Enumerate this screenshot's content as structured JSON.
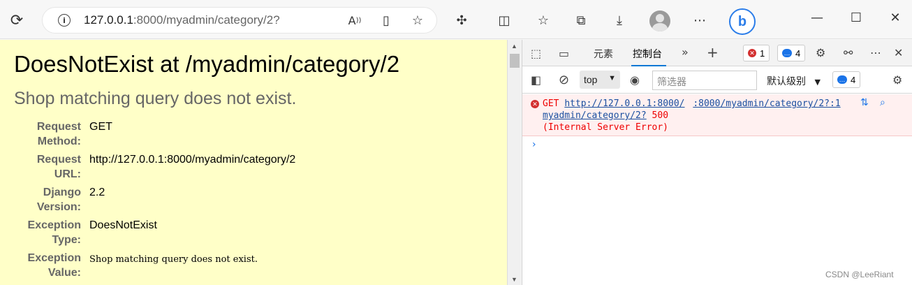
{
  "browser": {
    "url_host": "127.0.0.1",
    "url_rest": ":8000/myadmin/category/2?",
    "icons": [
      "refresh-icon",
      "info-icon",
      "read-aloud-icon",
      "immersive-reader-icon",
      "favorite-add-icon",
      "extensions-icon",
      "split-screen-icon",
      "favorites-icon",
      "collections-icon",
      "downloads-icon",
      "profile-avatar",
      "more-icon",
      "bing-icon",
      "minimize-icon",
      "maximize-icon",
      "close-icon"
    ]
  },
  "page": {
    "title": "DoesNotExist at /myadmin/category/2",
    "subtitle": "Shop matching query does not exist.",
    "meta": [
      {
        "key1": "Request",
        "key2": "Method:",
        "value": "GET"
      },
      {
        "key1": "Request",
        "key2": "URL:",
        "value": "http://127.0.0.1:8000/myadmin/category/2"
      },
      {
        "key1": "Django",
        "key2": "Version:",
        "value": "2.2"
      },
      {
        "key1": "Exception",
        "key2": "Type:",
        "value": "DoesNotExist"
      },
      {
        "key1": "Exception",
        "key2": "Value:",
        "value": "Shop matching query does not exist."
      }
    ]
  },
  "devtools": {
    "tabs": [
      "元素",
      "控制台"
    ],
    "active_tab": "控制台",
    "error_count": "1",
    "message_count": "4",
    "context": "top",
    "filter_placeholder": "筛选器",
    "level_label": "默认级别",
    "level_count": "4",
    "log": {
      "method": "GET",
      "url_part1": "http://127.0.0.1:8000/",
      "url_part2": "myadmin/category/2?",
      "source": ":8000/myadmin/category/2?:1",
      "status": "500",
      "status_text": "(Internal Server Error)"
    }
  },
  "watermark": "CSDN @LeeRiant"
}
